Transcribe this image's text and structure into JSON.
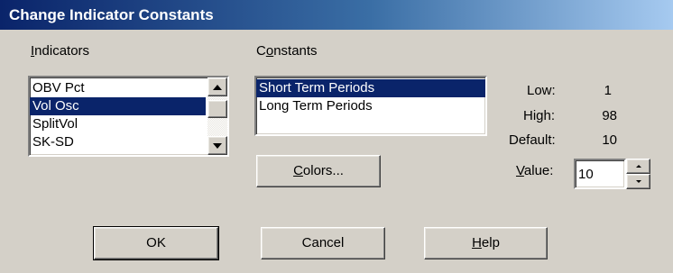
{
  "window": {
    "title": "Change Indicator Constants"
  },
  "indicators": {
    "label_accel": "I",
    "label_rest": "ndicators",
    "items": [
      "OBV Pct",
      "Vol Osc",
      "SplitVol",
      "SK-SD"
    ],
    "selected_index": 1
  },
  "constants": {
    "label_pre": "C",
    "label_accel": "o",
    "label_rest": "nstants",
    "items": [
      "Short Term Periods",
      "Long Term Periods"
    ],
    "selected_index": 0
  },
  "values": {
    "low_label": "Low:",
    "low_value": "1",
    "high_label": "High:",
    "high_value": "98",
    "default_label": "Default:",
    "default_value": "10",
    "value_label_accel": "V",
    "value_label_rest": "alue:",
    "value_input": "10"
  },
  "buttons": {
    "colors_accel": "C",
    "colors_rest": "olors...",
    "ok": "OK",
    "cancel": "Cancel",
    "help_accel": "H",
    "help_rest": "elp"
  },
  "colors": {
    "titlebar_start": "#0a246a",
    "titlebar_end": "#a6caf0",
    "selection": "#0a246a",
    "dialog_face": "#d4d0c8"
  }
}
